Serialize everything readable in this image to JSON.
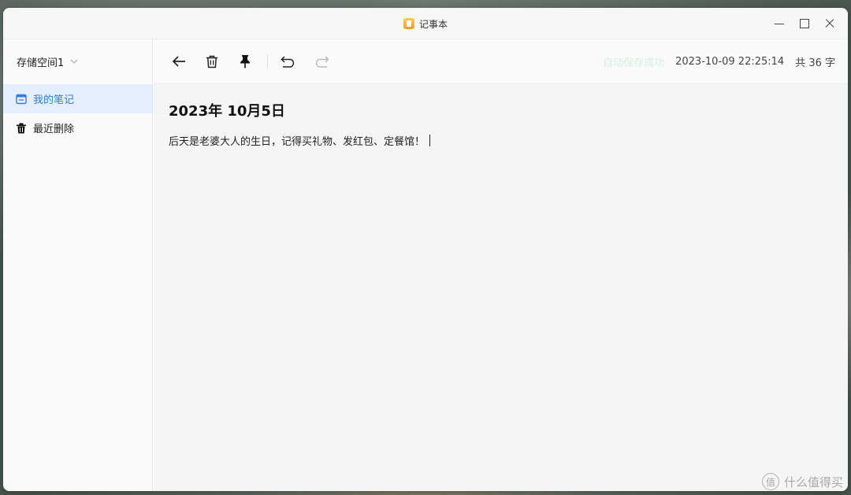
{
  "window": {
    "title": "记事本"
  },
  "sidebar": {
    "storage_label": "存储空间1",
    "items": [
      {
        "label": "我的笔记",
        "icon": "notebook-icon",
        "active": true
      },
      {
        "label": "最近删除",
        "icon": "trash-icon",
        "active": false
      }
    ]
  },
  "toolbar": {
    "icons": [
      "back-arrow-icon",
      "delete-icon",
      "pin-icon",
      "undo-icon",
      "redo-icon"
    ],
    "autosave_status": "自动保存成功",
    "timestamp": "2023-10-09 22:25:14",
    "word_count": "共 36 字"
  },
  "note": {
    "title": "2023年 10月5日",
    "body": "后天是老婆大人的生日，记得买礼物、发红包、定餐馆！"
  },
  "watermark": {
    "badge": "值",
    "text": "什么值得买"
  },
  "colors": {
    "accent": "#2f7de1",
    "active_bg": "#e4eefc",
    "autosave": "#d6efe0"
  }
}
